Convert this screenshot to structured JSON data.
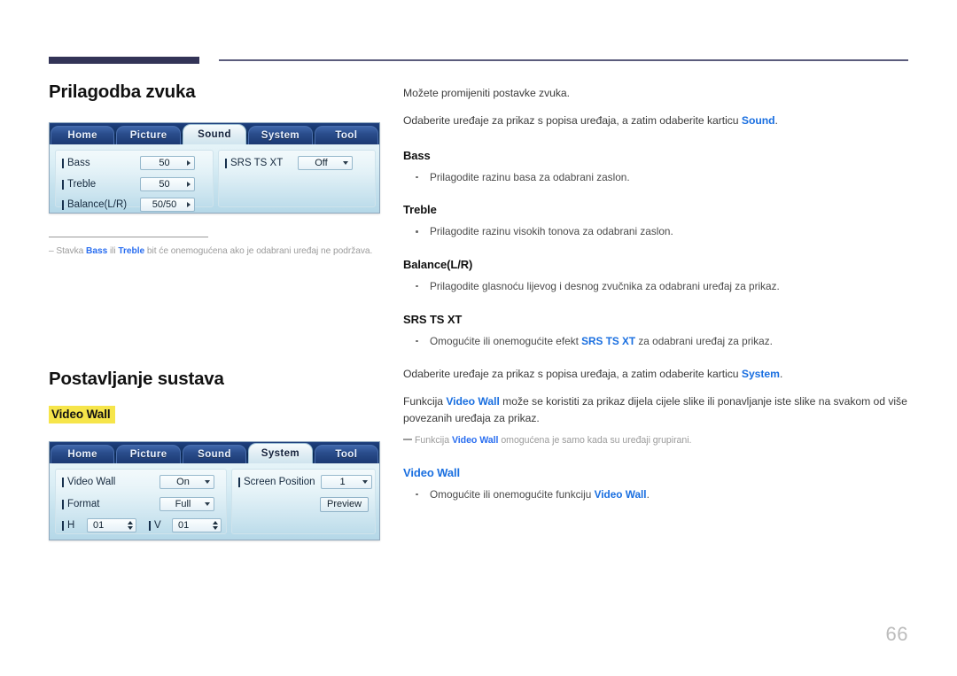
{
  "page": {
    "number": "66"
  },
  "sections": [
    {
      "title": "Prilagodba zvuka",
      "osd": {
        "tabs": [
          "Home",
          "Picture",
          "Sound",
          "System",
          "Tool"
        ],
        "active_tab": "Sound",
        "rows": [
          {
            "label": "Bass",
            "value": "50",
            "control": "stepper-right"
          },
          {
            "label": "Treble",
            "value": "50",
            "control": "stepper-right"
          },
          {
            "label": "Balance(L/R)",
            "value": "50/50",
            "control": "stepper-right"
          },
          {
            "label": "SRS TS XT",
            "value": "Off",
            "control": "dropdown"
          }
        ]
      },
      "note": {
        "pre": "Stavka ",
        "b1": "Bass",
        "mid1": " ili ",
        "b2": "Treble",
        "post": " bit će onemogućena ako je odabrani uređaj ne podržava."
      },
      "intro": [
        "Možete promijeniti postavke zvuka.",
        "Odaberite uređaje za prikaz s popisa uređaja, a zatim odaberite karticu Sound."
      ],
      "intro2_pre": "Odaberite uređaje za prikaz s popisa uređaja, a zatim odaberite karticu ",
      "intro2_link": "Sound",
      "intro2_post": ".",
      "items": [
        {
          "heading": "Bass",
          "heading_style": "black",
          "bullets": [
            {
              "pre": "Prilagodite razinu basa za odabrani zaslon.",
              "link": "",
              "post": ""
            }
          ]
        },
        {
          "heading": "Treble",
          "heading_style": "black",
          "bullets": [
            {
              "pre": "Prilagodite razinu visokih tonova za odabrani zaslon.",
              "link": "",
              "post": ""
            }
          ]
        },
        {
          "heading": "Balance(L/R)",
          "heading_style": "black",
          "bullets": [
            {
              "pre": "Prilagodite glasnoću lijevog i desnog zvučnika za odabrani uređaj za prikaz.",
              "link": "",
              "post": ""
            }
          ]
        },
        {
          "heading": "SRS TS XT",
          "heading_style": "black",
          "bullets": [
            {
              "pre": "Omogućite ili onemogućite efekt ",
              "link": "SRS TS XT",
              "post": " za odabrani uređaj za prikaz."
            }
          ]
        }
      ]
    },
    {
      "title": "Postavljanje sustava",
      "highlight_label": "Video Wall",
      "osd": {
        "tabs": [
          "Home",
          "Picture",
          "Sound",
          "System",
          "Tool"
        ],
        "active_tab": "System",
        "rows": [
          {
            "label": "Video Wall",
            "value": "On",
            "control": "dropdown"
          },
          {
            "label": "Format",
            "value": "Full",
            "control": "dropdown"
          },
          {
            "label": "H",
            "value": "01",
            "control": "spinner"
          },
          {
            "label": "V",
            "value": "01",
            "control": "spinner"
          },
          {
            "label": "Screen Position",
            "value": "1",
            "control": "dropdown"
          }
        ],
        "preview_button": "Preview"
      },
      "intro2_pre": "Odaberite uređaje za prikaz s popisa uređaja, a zatim odaberite karticu ",
      "intro2_link": "System",
      "intro2_post": ".",
      "para_pre": "Funkcija ",
      "para_link": "Video Wall",
      "para_post": " može se koristiti za prikaz dijela cijele slike ili ponavljanje iste slike na svakom od više povezanih uređaja za prikaz.",
      "dashnote_pre": "Funkcija ",
      "dashnote_link": "Video Wall",
      "dashnote_post": " omogućena je samo kada su uređaji grupirani.",
      "items": [
        {
          "heading": "Video Wall",
          "heading_style": "blue",
          "bullets": [
            {
              "pre": "Omogućite ili onemogućite funkciju ",
              "link": "Video Wall",
              "post": "."
            }
          ]
        }
      ]
    }
  ]
}
